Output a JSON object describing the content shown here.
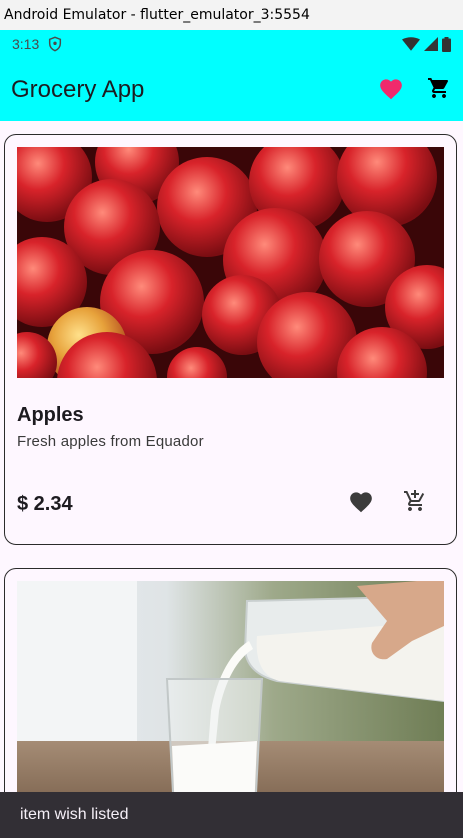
{
  "window": {
    "title": "Android Emulator - flutter_emulator_3:5554"
  },
  "status_bar": {
    "time": "3:13"
  },
  "app_bar": {
    "title": "Grocery App",
    "wishlist_icon": "heart-icon",
    "cart_icon": "cart-icon",
    "background": "#00ffff",
    "wishlist_color": "#f02a6c"
  },
  "products": [
    {
      "name": "Apples",
      "description": "Fresh apples from Equador",
      "price": "$ 2.34",
      "image": "apples-photo"
    },
    {
      "image": "milk-pour-photo"
    }
  ],
  "snackbar": {
    "message": "item wish listed"
  }
}
